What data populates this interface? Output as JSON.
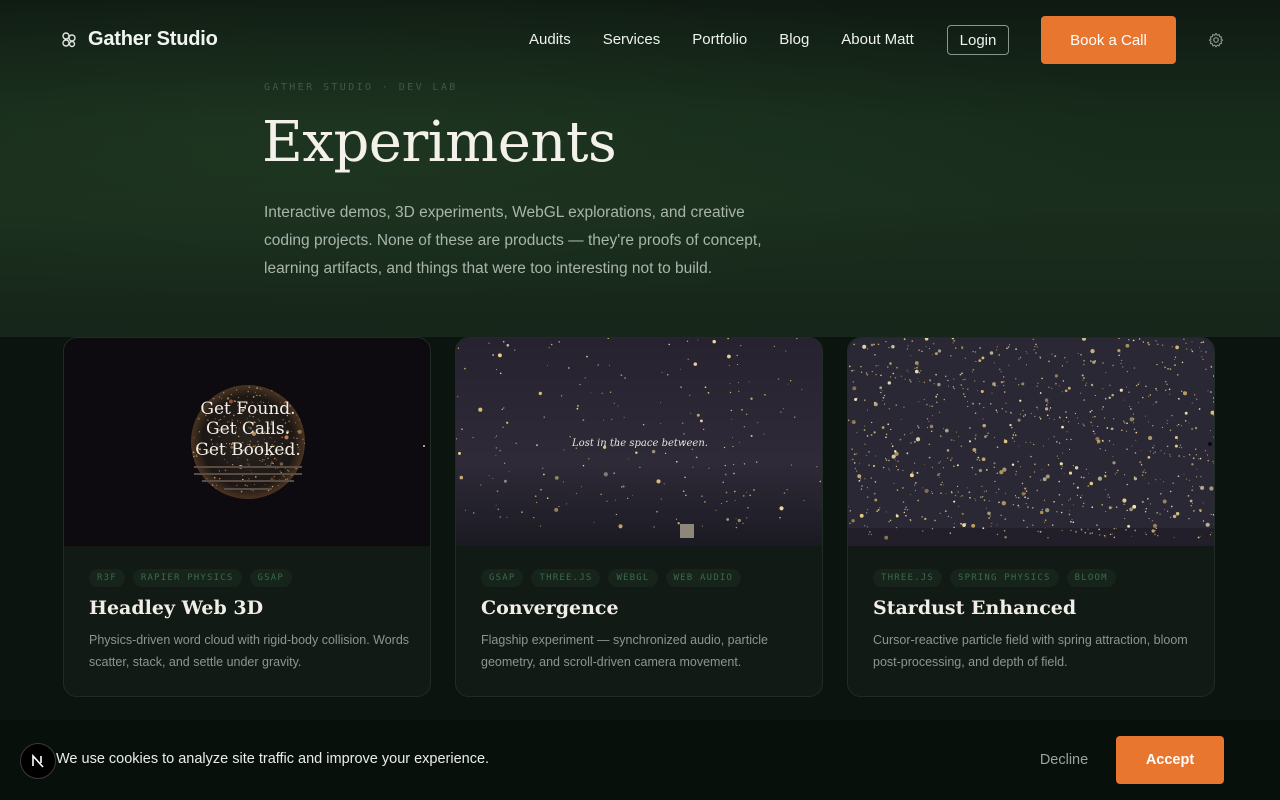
{
  "brand": {
    "name": "Gather Studio",
    "icon": "flower-logo-icon"
  },
  "nav": {
    "links": [
      "Audits",
      "Services",
      "Portfolio",
      "Blog",
      "About Matt"
    ],
    "login_label": "Login",
    "cta_label": "Book a Call",
    "settings_icon": "gear-icon"
  },
  "hero": {
    "eyebrow": "GATHER STUDIO · DEV LAB",
    "title": "Experiments",
    "intro": "Interactive demos, 3D experiments, WebGL explorations, and creative coding projects. None of these are products — they're proofs of concept, learning artifacts, and things that were too interesting not to build."
  },
  "cards": [
    {
      "tags": [
        "R3F",
        "RAPIER PHYSICS",
        "GSAP"
      ],
      "title": "Headley Web 3D",
      "description": "Physics-driven word cloud with rigid-body collision. Words scatter, stack, and settle under gravity.",
      "preview": {
        "headline_lines": [
          "Get Found.",
          "Get Calls.",
          "Get Booked."
        ]
      }
    },
    {
      "tags": [
        "GSAP",
        "THREE.JS",
        "WEBGL",
        "WEB AUDIO"
      ],
      "title": "Convergence",
      "description": "Flagship experiment — synchronized audio, particle geometry, and scroll-driven camera movement.",
      "preview": {
        "caption": "Lost in the space between."
      }
    },
    {
      "tags": [
        "THREE.JS",
        "SPRING PHYSICS",
        "BLOOM"
      ],
      "title": "Stardust Enhanced",
      "description": "Cursor-reactive particle field with spring attraction, bloom post-processing, and depth of field."
    }
  ],
  "cookie": {
    "message": "We use cookies to analyze site traffic and improve your experience.",
    "decline_label": "Decline",
    "accept_label": "Accept",
    "badge_letter": "N"
  },
  "colors": {
    "accent": "#e8762e",
    "tag_text": "#3b6a4a",
    "background": "#0c140f"
  }
}
